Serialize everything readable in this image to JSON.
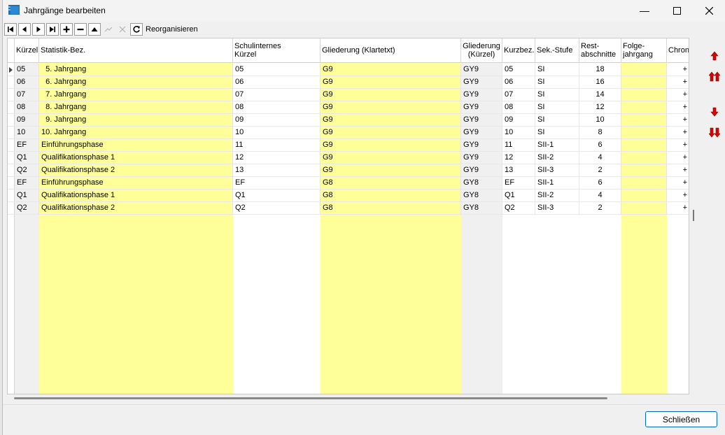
{
  "window": {
    "title": "Jahrgänge bearbeiten",
    "minimize": "—",
    "maximize": "☐",
    "close": "✕"
  },
  "toolbar": {
    "reorganize_label": "Reorganisieren"
  },
  "grid": {
    "headers": {
      "kuerzel": "Kürzel",
      "statistik": "Statistik-Bez.",
      "schulintern_1": "Schulinternes",
      "schulintern_2": "Kürzel",
      "gliederung_text": "Gliederung (Klartetxt)",
      "gliederung_k_1": "Gliederung",
      "gliederung_k_2": "(Kürzel)",
      "kurzbez": "Kurzbez.",
      "sekstufe": "Sek.-Stufe",
      "rest_1": "Rest-",
      "rest_2": "abschnitte",
      "folge_1": "Folge-",
      "folge_2": "jahrgang",
      "chrono": "Chrono"
    },
    "rows": [
      {
        "kuerzel": "05",
        "statistik": "  5. Jahrgang",
        "schulintern": "05",
        "glText": "G9",
        "glK": "GY9",
        "kurz": "05",
        "sek": "SI",
        "rest": "18",
        "folge": "",
        "chrono": "+"
      },
      {
        "kuerzel": "06",
        "statistik": "  6. Jahrgang",
        "schulintern": "06",
        "glText": "G9",
        "glK": "GY9",
        "kurz": "06",
        "sek": "SI",
        "rest": "16",
        "folge": "",
        "chrono": "+"
      },
      {
        "kuerzel": "07",
        "statistik": "  7. Jahrgang",
        "schulintern": "07",
        "glText": "G9",
        "glK": "GY9",
        "kurz": "07",
        "sek": "SI",
        "rest": "14",
        "folge": "",
        "chrono": "+"
      },
      {
        "kuerzel": "08",
        "statistik": "  8. Jahrgang",
        "schulintern": "08",
        "glText": "G9",
        "glK": "GY9",
        "kurz": "08",
        "sek": "SI",
        "rest": "12",
        "folge": "",
        "chrono": "+"
      },
      {
        "kuerzel": "09",
        "statistik": "  9. Jahrgang",
        "schulintern": "09",
        "glText": "G9",
        "glK": "GY9",
        "kurz": "09",
        "sek": "SI",
        "rest": "10",
        "folge": "",
        "chrono": "+"
      },
      {
        "kuerzel": "10",
        "statistik": "10. Jahrgang",
        "schulintern": "10",
        "glText": "G9",
        "glK": "GY9",
        "kurz": "10",
        "sek": "SI",
        "rest": "8",
        "folge": "",
        "chrono": "+"
      },
      {
        "kuerzel": "EF",
        "statistik": "Einführungsphase",
        "schulintern": "11",
        "glText": "G9",
        "glK": "GY9",
        "kurz": "11",
        "sek": "SII-1",
        "rest": "6",
        "folge": "",
        "chrono": "+"
      },
      {
        "kuerzel": "Q1",
        "statistik": "Qualifikationsphase 1",
        "schulintern": "12",
        "glText": "G9",
        "glK": "GY9",
        "kurz": "12",
        "sek": "SII-2",
        "rest": "4",
        "folge": "",
        "chrono": "+"
      },
      {
        "kuerzel": "Q2",
        "statistik": "Qualifikationsphase 2",
        "schulintern": "13",
        "glText": "G9",
        "glK": "GY9",
        "kurz": "13",
        "sek": "SII-3",
        "rest": "2",
        "folge": "",
        "chrono": "+"
      },
      {
        "kuerzel": "EF",
        "statistik": "Einführungsphase",
        "schulintern": "EF",
        "glText": "G8",
        "glK": "GY8",
        "kurz": "EF",
        "sek": "SII-1",
        "rest": "6",
        "folge": "",
        "chrono": "+"
      },
      {
        "kuerzel": "Q1",
        "statistik": "Qualifikationsphase 1",
        "schulintern": "Q1",
        "glText": "G8",
        "glK": "GY8",
        "kurz": "Q1",
        "sek": "SII-2",
        "rest": "4",
        "folge": "",
        "chrono": "+"
      },
      {
        "kuerzel": "Q2",
        "statistik": "Qualifikationsphase 2",
        "schulintern": "Q2",
        "glText": "G8",
        "glK": "GY8",
        "kurz": "Q2",
        "sek": "SII-3",
        "rest": "2",
        "folge": "",
        "chrono": "+"
      }
    ]
  },
  "footer": {
    "close_label": "Schließen"
  },
  "colors": {
    "editable_yellow": "#ffff99",
    "readonly_gray": "#f0f0f0",
    "arrow_red": "#e00000"
  }
}
